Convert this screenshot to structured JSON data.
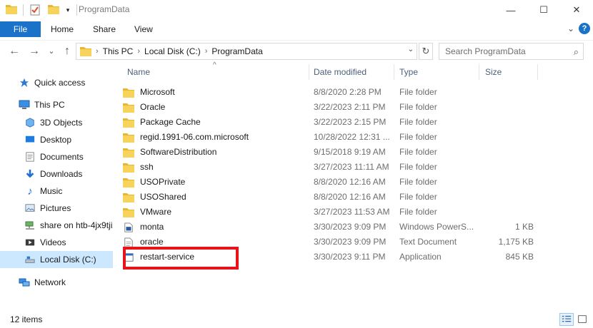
{
  "window": {
    "title": "ProgramData",
    "minimize_glyph": "—",
    "maximize_glyph": "☐",
    "close_glyph": "✕"
  },
  "ribbon": {
    "tabs": [
      "File",
      "Home",
      "Share",
      "View"
    ],
    "help_glyph": "?",
    "expand_glyph": "⌄"
  },
  "nav": {
    "back_glyph": "←",
    "forward_glyph": "→",
    "recent_glyph": "⌄",
    "up_glyph": "↑",
    "breadcrumb": [
      "This PC",
      "Local Disk (C:)",
      "ProgramData"
    ],
    "crumb_sep": "›",
    "refresh_glyph": "↻",
    "search_placeholder": "Search ProgramData",
    "search_value": ""
  },
  "sidebar": {
    "items": [
      {
        "label": "Quick access",
        "icon": "star-icon"
      },
      {
        "label": "This PC",
        "icon": "pc-icon"
      },
      {
        "label": "3D Objects",
        "icon": "cube-icon"
      },
      {
        "label": "Desktop",
        "icon": "desktop-icon"
      },
      {
        "label": "Documents",
        "icon": "documents-icon"
      },
      {
        "label": "Downloads",
        "icon": "download-icon"
      },
      {
        "label": "Music",
        "icon": "music-icon"
      },
      {
        "label": "Pictures",
        "icon": "pictures-icon"
      },
      {
        "label": "share on htb-4jx9tjix",
        "icon": "network-drive-icon"
      },
      {
        "label": "Videos",
        "icon": "videos-icon"
      },
      {
        "label": "Local Disk (C:)",
        "icon": "disk-icon"
      },
      {
        "label": "Network",
        "icon": "network-icon"
      }
    ]
  },
  "columns": {
    "name": "Name",
    "date": "Date modified",
    "type": "Type",
    "size": "Size"
  },
  "files": [
    {
      "name": "Microsoft",
      "date": "8/8/2020 2:28 PM",
      "type": "File folder",
      "size": "",
      "icon": "folder-icon"
    },
    {
      "name": "Oracle",
      "date": "3/22/2023 2:11 PM",
      "type": "File folder",
      "size": "",
      "icon": "folder-icon"
    },
    {
      "name": "Package Cache",
      "date": "3/22/2023 2:15 PM",
      "type": "File folder",
      "size": "",
      "icon": "folder-icon"
    },
    {
      "name": "regid.1991-06.com.microsoft",
      "date": "10/28/2022 12:31 ...",
      "type": "File folder",
      "size": "",
      "icon": "folder-icon"
    },
    {
      "name": "SoftwareDistribution",
      "date": "9/15/2018 9:19 AM",
      "type": "File folder",
      "size": "",
      "icon": "folder-icon"
    },
    {
      "name": "ssh",
      "date": "3/27/2023 11:11 AM",
      "type": "File folder",
      "size": "",
      "icon": "folder-icon"
    },
    {
      "name": "USOPrivate",
      "date": "8/8/2020 12:16 AM",
      "type": "File folder",
      "size": "",
      "icon": "folder-icon"
    },
    {
      "name": "USOShared",
      "date": "8/8/2020 12:16 AM",
      "type": "File folder",
      "size": "",
      "icon": "folder-icon"
    },
    {
      "name": "VMware",
      "date": "3/27/2023 11:53 AM",
      "type": "File folder",
      "size": "",
      "icon": "folder-icon"
    },
    {
      "name": "monta",
      "date": "3/30/2023 9:09 PM",
      "type": "Windows PowerS...",
      "size": "1 KB",
      "icon": "powershell-script-icon"
    },
    {
      "name": "oracle",
      "date": "3/30/2023 9:09 PM",
      "type": "Text Document",
      "size": "1,175 KB",
      "icon": "text-document-icon"
    },
    {
      "name": "restart-service",
      "date": "3/30/2023 9:11 PM",
      "type": "Application",
      "size": "845 KB",
      "icon": "application-icon"
    }
  ],
  "status": {
    "item_count": "12 items"
  },
  "colors": {
    "accent": "#1a73c9",
    "selected_bg": "#cce8ff",
    "highlight": "#e8141b",
    "folder": "#f4c542"
  }
}
